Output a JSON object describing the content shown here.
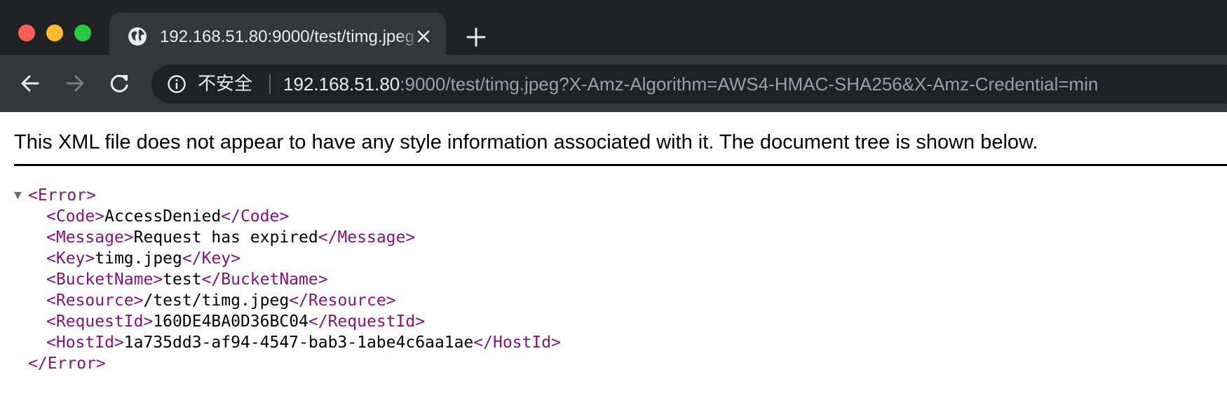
{
  "browser": {
    "tab": {
      "title": "192.168.51.80:9000/test/timg.jpeg",
      "favicon": "globe-icon"
    },
    "address_bar": {
      "security_label": "不安全",
      "url_host": "192.168.51.80",
      "url_rest": ":9000/test/timg.jpeg?X-Amz-Algorithm=AWS4-HMAC-SHA256&X-Amz-Credential=min"
    },
    "colors": {
      "frame": "#202124",
      "toolbar": "#35363a",
      "tag": "#881280"
    }
  },
  "page": {
    "notice": "This XML file does not appear to have any style information associated with it. The document tree is shown below.",
    "xml": {
      "root_open": "<Error>",
      "root_close": "</Error>",
      "rows": [
        {
          "open": "<Code>",
          "value": "AccessDenied",
          "close": "</Code>"
        },
        {
          "open": "<Message>",
          "value": "Request has expired",
          "close": "</Message>"
        },
        {
          "open": "<Key>",
          "value": "timg.jpeg",
          "close": "</Key>"
        },
        {
          "open": "<BucketName>",
          "value": "test",
          "close": "</BucketName>"
        },
        {
          "open": "<Resource>",
          "value": "/test/timg.jpeg",
          "close": "</Resource>"
        },
        {
          "open": "<RequestId>",
          "value": "160DE4BA0D36BC04",
          "close": "</RequestId>"
        },
        {
          "open": "<HostId>",
          "value": "1a735dd3-af94-4547-bab3-1abe4c6aa1ae",
          "close": "</HostId>"
        }
      ]
    }
  }
}
